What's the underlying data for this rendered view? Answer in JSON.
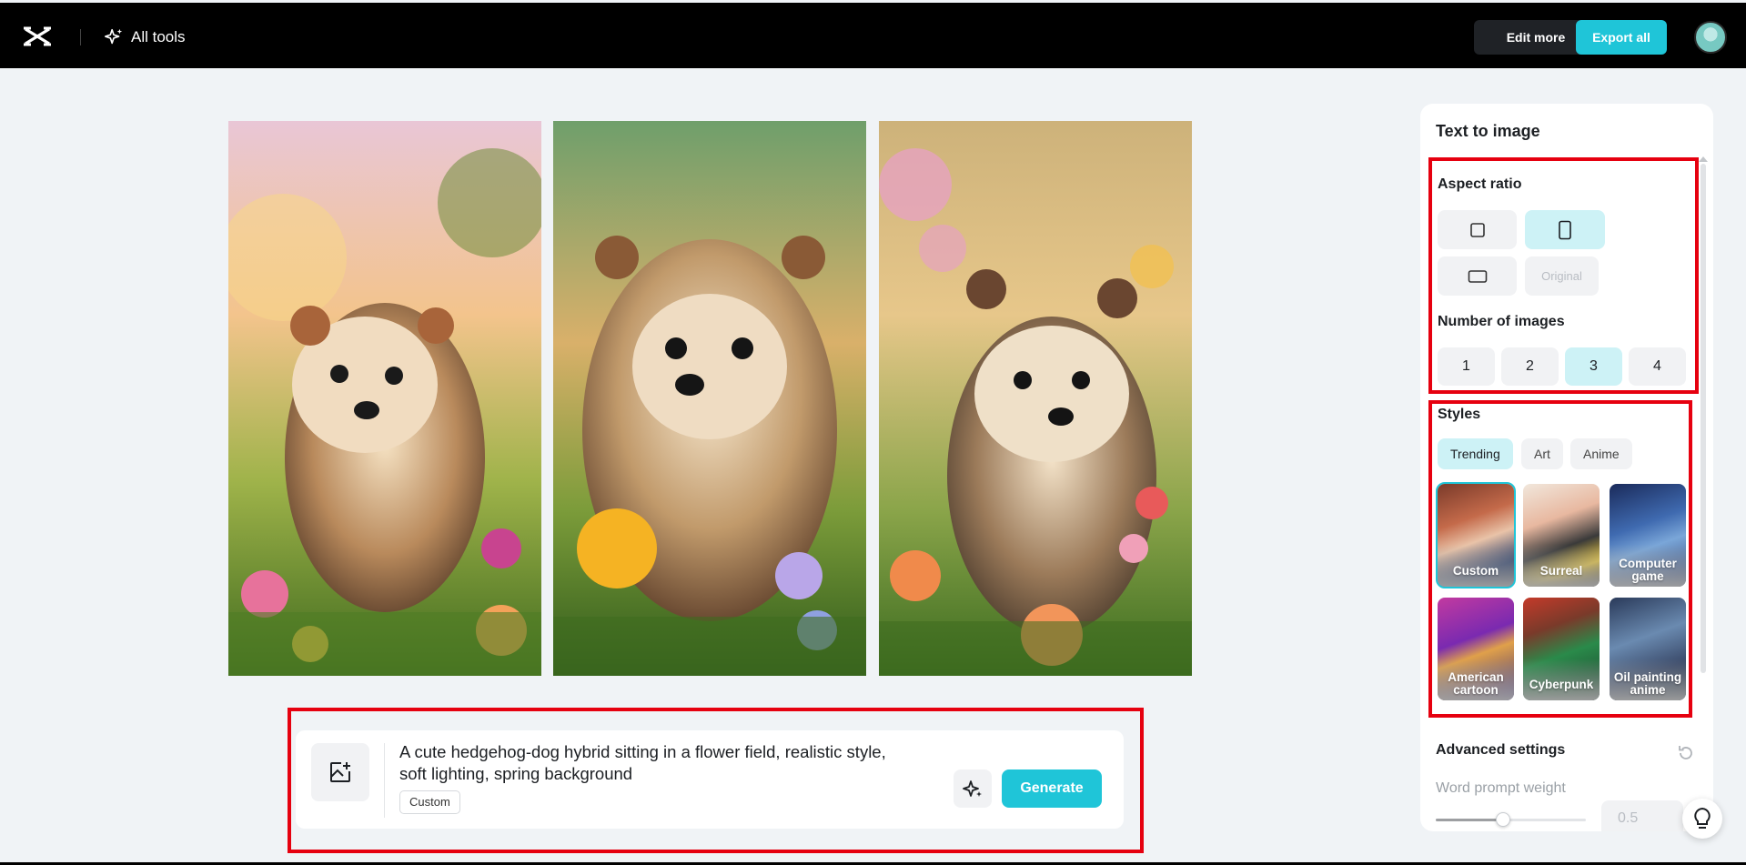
{
  "header": {
    "logo_icon": "capcut-logo-icon",
    "all_tools_label": "All tools",
    "edit_more_label": "Edit more",
    "export_all_label": "Export all",
    "accent_color": "#1fc5d8"
  },
  "gallery": {
    "images": [
      {
        "name": "generated-image-1",
        "subject": "hedgehog-dog in flower field"
      },
      {
        "name": "generated-image-2",
        "subject": "hedgehog-dog in flower field"
      },
      {
        "name": "generated-image-3",
        "subject": "hedgehog-dog in flower field"
      }
    ]
  },
  "prompt": {
    "text": "A cute hedgehog-dog hybrid sitting in a flower field, realistic style, soft lighting, spring background",
    "style_tag": "Custom",
    "generate_label": "Generate"
  },
  "panel": {
    "title": "Text to image",
    "aspect_ratio": {
      "label": "Aspect ratio",
      "options": [
        "square",
        "portrait",
        "landscape",
        "Original"
      ],
      "selected": "portrait",
      "original_label": "Original"
    },
    "number_of_images": {
      "label": "Number of images",
      "options": [
        "1",
        "2",
        "3",
        "4"
      ],
      "selected": "3"
    },
    "styles": {
      "label": "Styles",
      "tabs": [
        "Trending",
        "Art",
        "Anime"
      ],
      "active_tab": "Trending",
      "items": [
        {
          "label": "Custom",
          "selected": true
        },
        {
          "label": "Surreal",
          "selected": false
        },
        {
          "label": "Computer game",
          "selected": false
        },
        {
          "label": "American cartoon",
          "selected": false
        },
        {
          "label": "Cyberpunk",
          "selected": false
        },
        {
          "label": "Oil painting anime",
          "selected": false
        }
      ]
    },
    "advanced": {
      "label": "Advanced settings",
      "word_prompt_weight_label": "Word prompt weight",
      "word_prompt_weight_value": "0.5",
      "word_prompt_weight_fraction": 0.45
    }
  }
}
